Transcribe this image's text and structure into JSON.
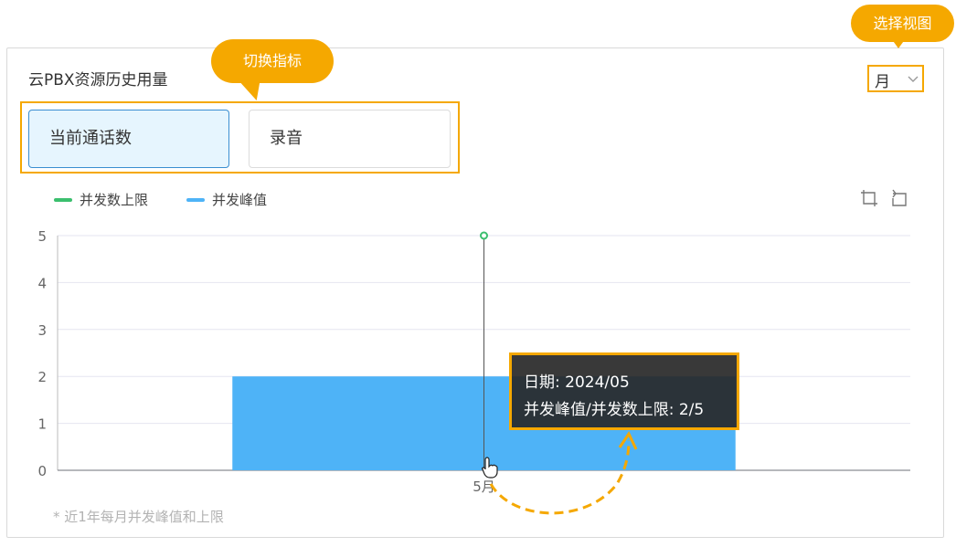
{
  "card": {
    "title": "云PBX资源历史用量",
    "view_select": {
      "value": "月"
    },
    "metric_tabs": [
      {
        "label": "当前通话数",
        "active": true
      },
      {
        "label": "录音",
        "active": false
      }
    ],
    "footnote": "* 近1年每月并发峰值和上限"
  },
  "callouts": {
    "metrics": "切换指标",
    "view": "选择视图"
  },
  "legend": [
    {
      "label": "并发数上限",
      "color": "#3bbf6e"
    },
    {
      "label": "并发峰值",
      "color": "#4eb3f7"
    }
  ],
  "toolbox": {
    "icons": [
      "zoom-select-icon",
      "zoom-reset-icon"
    ]
  },
  "tooltip": {
    "line1": "日期: 2024/05",
    "line2": "并发峰值/并发数上限: 2/5"
  },
  "chart_data": {
    "type": "bar",
    "categories": [
      "5月"
    ],
    "series": [
      {
        "name": "并发峰值",
        "type": "bar",
        "values": [
          2
        ],
        "color": "#4eb3f7"
      },
      {
        "name": "并发数上限",
        "type": "line",
        "values": [
          5
        ],
        "color": "#3bbf6e"
      }
    ],
    "ylim": [
      0,
      5
    ],
    "yticks": [
      0,
      1,
      2,
      3,
      4,
      5
    ],
    "grid": true,
    "legend_position": "top-left"
  },
  "colors": {
    "accent": "#f5a800",
    "active_tab_border": "#3a8ed1"
  }
}
